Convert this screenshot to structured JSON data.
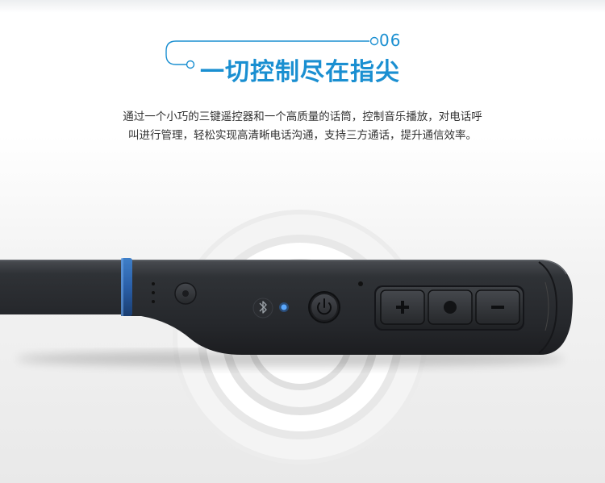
{
  "section": {
    "number": "06",
    "title": "一切控制尽在指尖"
  },
  "description": {
    "line1": "通过一个小巧的三键遥控器和一个高质量的话筒，控制音乐播放，对电话呼",
    "line2": "叫进行管理，轻松实现高清晰电话沟通，支持三方通话，提升通信效率。"
  },
  "product": {
    "buttons": [
      "plus-icon",
      "play-pause-icon",
      "minus-icon"
    ],
    "power_icon": "power-icon",
    "bluetooth_icon": "bluetooth-icon",
    "indicator": "led-indicator"
  },
  "colors": {
    "accent": "#1a8fd1",
    "body": "#2b2d30",
    "led": "#2f8cff"
  }
}
